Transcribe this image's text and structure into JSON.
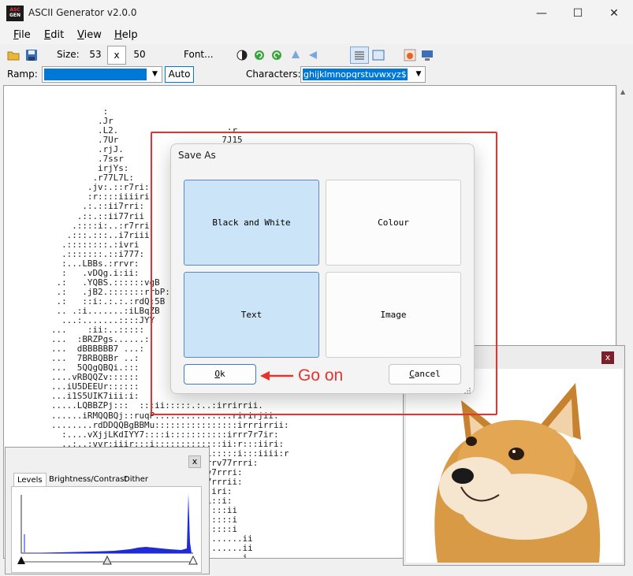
{
  "window": {
    "title": "ASCII Generator v2.0.0",
    "logo_top": "ASC",
    "logo_bottom": "GEN"
  },
  "titlebar_buttons": {
    "minimize": "—",
    "maximize": "☐",
    "close": "✕"
  },
  "menu": [
    {
      "label": "File",
      "mnemonic": "F",
      "rest": "ile"
    },
    {
      "label": "Edit",
      "mnemonic": "E",
      "rest": "dit"
    },
    {
      "label": "View",
      "mnemonic": "V",
      "rest": "iew"
    },
    {
      "label": "Help",
      "mnemonic": "H",
      "rest": "elp"
    }
  ],
  "toolbar": {
    "size_label": "Size:",
    "width": "53",
    "times": "x",
    "height": "50",
    "font_label": "Font..."
  },
  "ramp": {
    "label": "Ramp:",
    "auto_label": "Auto",
    "characters_label": "Characters:",
    "characters_value": "ghijklmnopqrstuvwxyz$"
  },
  "ascii_lines": [
    "          :",
    "         .Jr",
    "         .L2.                    .:r.",
    "         .7Ur                    7J15",
    "         .rjJ.",
    "         .7ssr",
    "         irjYs:",
    "        .r77L7L:",
    "       .jv:.::r7ri:",
    "       :r::::iiiiri",
    "      .:.::ii7rri:",
    "     .::.::ii77rii",
    "    .::::i:..:r7rri",
    "   .:::.:::..i7riii",
    "  .::::::::.:ivri",
    "  .:::::::.::i777:",
    "  :...LBBs.:rrvr:",
    "  :   .vDQg.i:ii:",
    " .:   .YQBS.::::::vgB",
    " .:   .jB2.:::::::rrbP:E",
    " .:   ::i:.:.:.:rdQ:5B",
    " .. .:i.......:iLBqZB",
    "  ...:.......::::JYY",
    "...    :ii:..:::::",
    "...  :BRZPgs......:",
    "...  dBBBBBB7 ...:",
    "...  7BRBQBBr ..:",
    "...  5QQgQBQi.:::",
    "....vRBQQZv::::::",
    "...iU5DEEUr::::::",
    "...i1S5UIK7iii:i:",
    ".....LQBBZPj:::  :::ii:::::.:..:irrirrii.",
    "......iRMQQBQj::ruqP::::::....:..::ririrjii.",
    "........rdDDQQBgBBMu::::::::::::::::irrrirrii:",
    "  :....vXjjLKdIYY7::::i:::::::::::irrr7r7ir:",
    "  ..:..:vvr:iiir:::i:::::::::::::ii:r:::iiri:",
    "  ....................:i7iii::i:::::i:::iiii:r",
    "  ....................:::::irrrrv77rrri:",
    "  ....................ii:irrYLv7rrri:",
    "  ....................::irr7vL7rrrii:",
    "  ....................ii:r777r:iri:",
    "  ....................::r7777ii::i:",
    "  ....................::rrri7i::::ii",
    "  ....................ii::.::::::::i",
    "  ....................::i::::::::::i",
    "  ...................................ii",
    "  ...................................ii",
    "  ...................................i"
  ],
  "levels": {
    "tabs": [
      "Levels",
      "Brightness/Contrast",
      "Dither"
    ],
    "close_label": "x"
  },
  "doge": {
    "close_label": "x"
  },
  "dialog": {
    "title": "Save As",
    "options": [
      {
        "label": "Black and White",
        "selected": true
      },
      {
        "label": "Colour",
        "selected": false
      },
      {
        "label": "Text",
        "selected": true
      },
      {
        "label": "Image",
        "selected": false
      }
    ],
    "ok": {
      "mnemonic": "O",
      "rest": "k"
    },
    "cancel": {
      "mnemonic": "C",
      "rest": "ancel"
    }
  },
  "annotation": {
    "text": "Go on",
    "color": "#e8322d"
  },
  "colors": {
    "accent": "#0078d7",
    "selected_tile": "#cce4f7",
    "annotation": "#e8322d",
    "histogram": "#1f2bd6"
  }
}
